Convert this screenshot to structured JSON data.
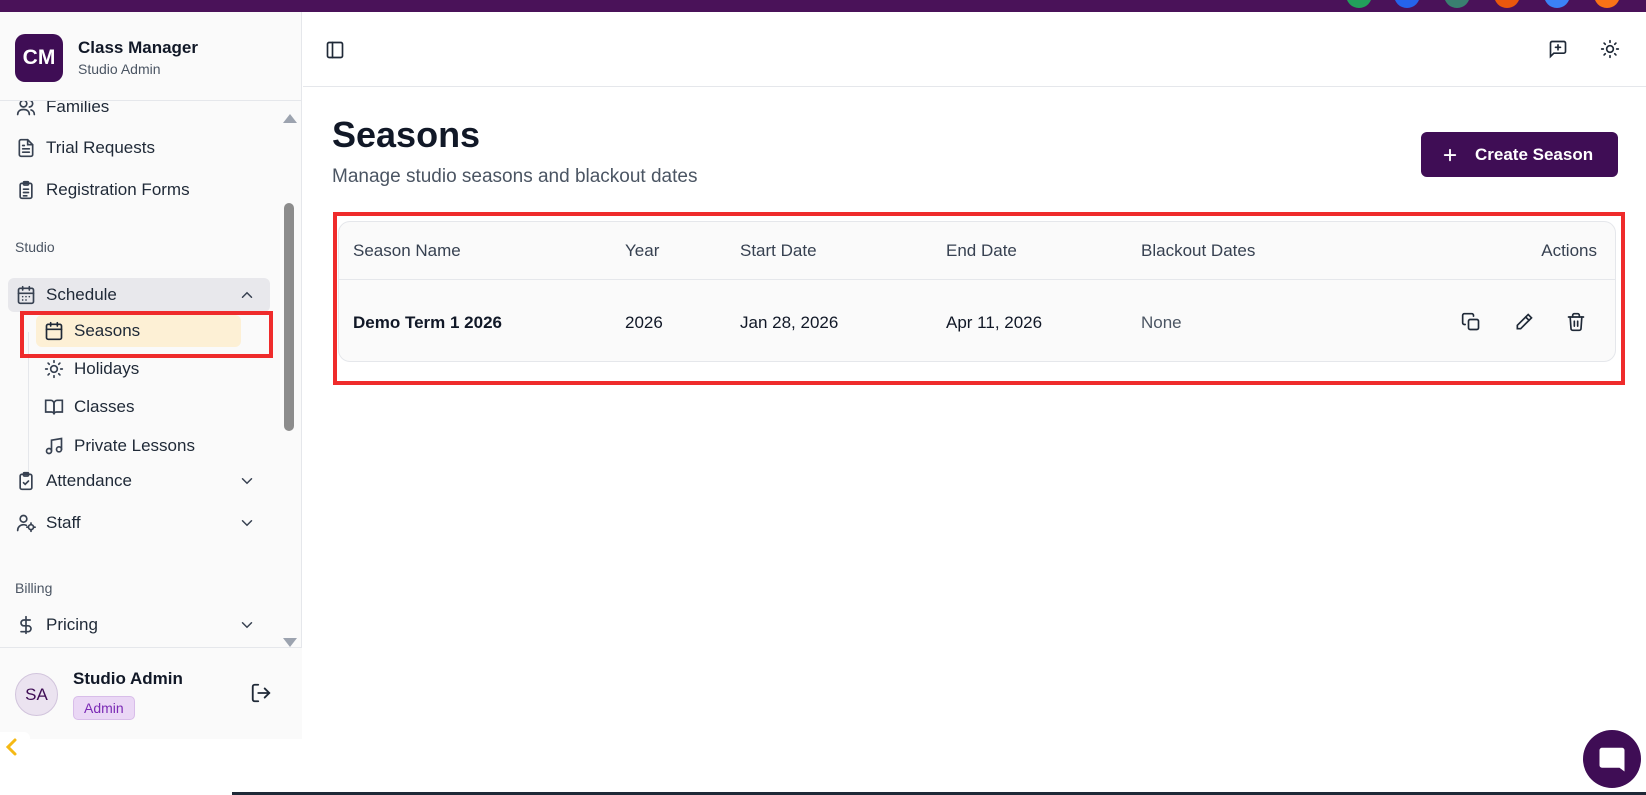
{
  "app": {
    "logo_text": "CM",
    "title": "Class Manager",
    "subtitle": "Studio Admin"
  },
  "sidebar": {
    "items_top": [
      {
        "label": "Families",
        "icon": "users-icon"
      },
      {
        "label": "Trial Requests",
        "icon": "file-text-icon"
      },
      {
        "label": "Registration Forms",
        "icon": "clipboard-list-icon"
      }
    ],
    "section_studio": "Studio",
    "schedule": {
      "label": "Schedule",
      "icon": "calendar-icon",
      "expanded": true
    },
    "schedule_children": [
      {
        "label": "Seasons",
        "icon": "calendar-icon",
        "active": true
      },
      {
        "label": "Holidays",
        "icon": "sun-icon"
      },
      {
        "label": "Classes",
        "icon": "book-open-icon"
      },
      {
        "label": "Private Lessons",
        "icon": "music-icon"
      }
    ],
    "attendance": {
      "label": "Attendance",
      "icon": "clipboard-check-icon"
    },
    "staff": {
      "label": "Staff",
      "icon": "user-cog-icon"
    },
    "section_billing": "Billing",
    "pricing": {
      "label": "Pricing",
      "icon": "dollar-icon"
    }
  },
  "user": {
    "initials": "SA",
    "name": "Studio Admin",
    "role": "Admin"
  },
  "page": {
    "title": "Seasons",
    "subtitle": "Manage studio seasons and blackout dates",
    "create_label": "Create Season"
  },
  "table": {
    "columns": [
      "Season Name",
      "Year",
      "Start Date",
      "End Date",
      "Blackout Dates",
      "Actions"
    ],
    "rows": [
      {
        "name": "Demo Term 1 2026",
        "year": "2026",
        "start": "Jan 28, 2026",
        "end": "Apr 11, 2026",
        "blackout": "None"
      }
    ]
  },
  "colors": {
    "brand": "#3f0d55",
    "active_bg": "#fdf0d5",
    "highlight": "#ef2b2b"
  }
}
